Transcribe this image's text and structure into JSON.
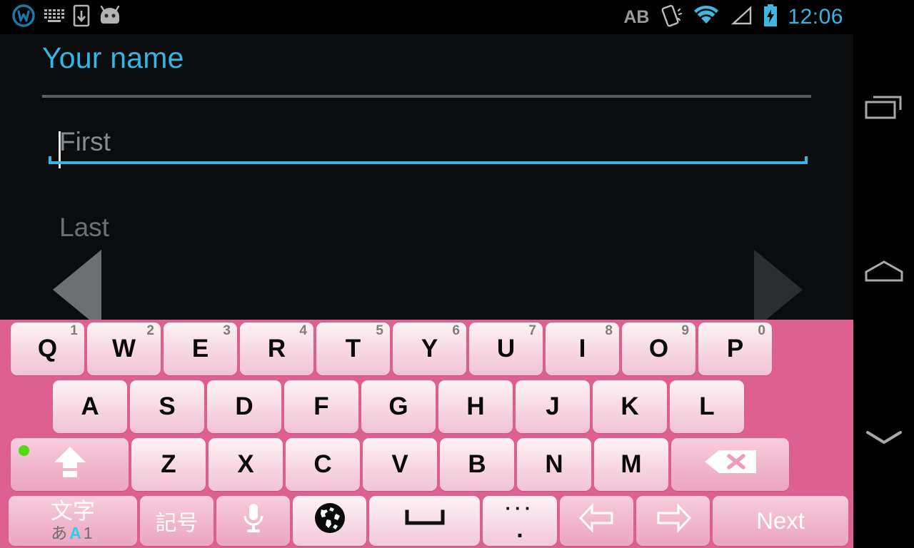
{
  "status_bar": {
    "left_icons": [
      "app-logo-icon",
      "keyboard-icon",
      "download-to-device-icon",
      "android-robot-icon"
    ],
    "ab_label": "AB",
    "right_icons": [
      "vibrate-icon",
      "wifi-icon",
      "signal-icon",
      "battery-charging-icon"
    ],
    "time": "12:06",
    "time_color": "#33b5e5"
  },
  "content": {
    "title": "Your name",
    "title_color": "#33b5e5",
    "fields": [
      {
        "name": "first",
        "placeholder": "First",
        "value": "",
        "focused": true
      },
      {
        "name": "last",
        "placeholder": "Last",
        "value": "",
        "focused": false
      }
    ],
    "nav_prev_label": "Previous",
    "nav_next_label": "Next"
  },
  "keyboard": {
    "background_color": "#de6090",
    "row1": [
      {
        "label": "Q",
        "sup": "1"
      },
      {
        "label": "W",
        "sup": "2"
      },
      {
        "label": "E",
        "sup": "3"
      },
      {
        "label": "R",
        "sup": "4"
      },
      {
        "label": "T",
        "sup": "5"
      },
      {
        "label": "Y",
        "sup": "6"
      },
      {
        "label": "U",
        "sup": "7"
      },
      {
        "label": "I",
        "sup": "8"
      },
      {
        "label": "O",
        "sup": "9"
      },
      {
        "label": "P",
        "sup": "0"
      }
    ],
    "row2": [
      {
        "label": "A"
      },
      {
        "label": "S"
      },
      {
        "label": "D"
      },
      {
        "label": "F"
      },
      {
        "label": "G"
      },
      {
        "label": "H"
      },
      {
        "label": "J"
      },
      {
        "label": "K"
      },
      {
        "label": "L"
      }
    ],
    "row3": [
      {
        "label": "Z"
      },
      {
        "label": "X"
      },
      {
        "label": "C"
      },
      {
        "label": "V"
      },
      {
        "label": "B"
      },
      {
        "label": "N"
      },
      {
        "label": "M"
      }
    ],
    "shift": {
      "icon": "caps-lock-arrow-icon",
      "caps_lock_on": true,
      "led_color": "#4ddb11"
    },
    "backspace": {
      "icon": "backspace-icon"
    },
    "row4": {
      "moji": {
        "top": "文字",
        "sub_kana": "あ",
        "sub_alpha": "A",
        "sub_num": "1",
        "active": "A"
      },
      "kigou": "記号",
      "mic": "microphone-icon",
      "globe": "globe-language-icon",
      "space": "space-bar-icon",
      "period": {
        "top": "···",
        "main": "."
      },
      "arrow_left": "arrow-left-icon",
      "arrow_right": "arrow-right-icon",
      "next": "Next"
    }
  },
  "navbar": {
    "recents_label": "Recents",
    "home_label": "Home",
    "hide_keyboard_label": "Hide keyboard"
  }
}
